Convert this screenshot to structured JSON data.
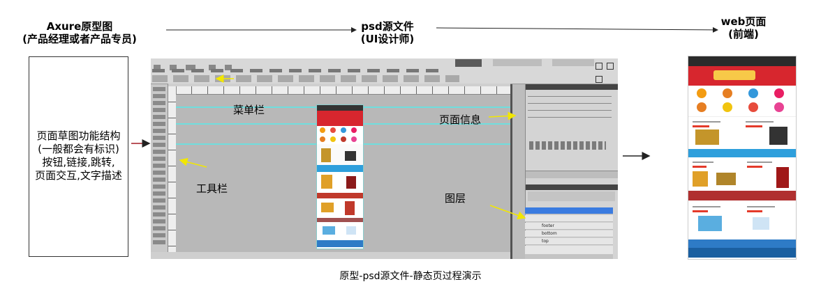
{
  "headers": {
    "axure_title": "Axure原型图",
    "axure_subtitle": "(产品经理或者产品专员)",
    "psd_title": "psd源文件",
    "psd_subtitle": "(UI设计师)",
    "web_title": "web页面",
    "web_subtitle": "(前端)"
  },
  "axure_box": {
    "lines": [
      "页面草图功能结构",
      "(一般都会有标识)",
      "按钮,链接,跳转,",
      "页面交互,文字描述"
    ]
  },
  "photoshop": {
    "label_menu": "菜单栏",
    "label_page_info": "页面信息",
    "label_toolbar": "工具栏",
    "label_layers": "图层",
    "layer_names": [
      "footer",
      "bottom",
      "top"
    ],
    "colors": {
      "workspace": "#535353",
      "canvas": "#b8b8b8",
      "guide": "#6fdede",
      "pointer_arrow": "#f2e700",
      "layer_selected": "#3a7be0"
    }
  },
  "footer": {
    "caption": "原型-psd源文件-静态页过程演示"
  },
  "colors": {
    "web_banner": "#d7262e",
    "web_header": "#2b2b2b"
  }
}
